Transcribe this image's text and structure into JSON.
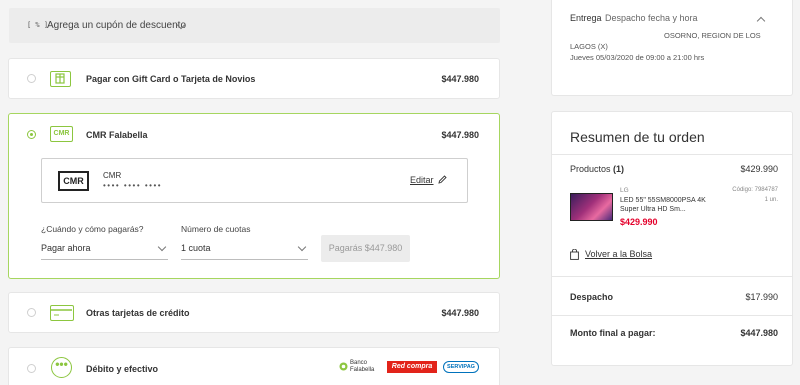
{
  "coupon": {
    "icon_text": "[ % ]",
    "label": "Agrega un cupón de descuento"
  },
  "payment_methods": {
    "giftcard": {
      "label": "Pagar con Gift Card o Tarjeta de Novios",
      "price": "$447.980"
    },
    "cmr": {
      "label": "CMR Falabella",
      "price": "$447.980",
      "icon_text": "CMR",
      "card": {
        "logo_text": "CMR",
        "name": "CMR",
        "masked_number": "•••• •••• ••••",
        "edit_label": "Editar"
      },
      "when_label": "¿Cuándo y cómo pagarás?",
      "when_value": "Pagar ahora",
      "installments_label": "Número de cuotas",
      "installments_value": "1 cuota",
      "pay_button": "Pagarás $447.980"
    },
    "credit": {
      "label": "Otras tarjetas de crédito",
      "price": "$447.980"
    },
    "debit": {
      "label": "Débito y efectivo",
      "logos": {
        "banco_line1": "Banco",
        "banco_line2": "Falabella",
        "redcompra": "Red compra",
        "servipag": "SERVIPAG"
      }
    }
  },
  "delivery": {
    "label": "Entrega",
    "sub_label": "Despacho fecha y hora",
    "address_line1": "OSORNO, REGION DE LOS",
    "address_line2": "LAGOS (X)",
    "schedule": "Jueves 05/03/2020 de 09:00 a 21:00 hrs"
  },
  "summary": {
    "title": "Resumen de tu orden",
    "products_label": "Productos",
    "products_count": "(1)",
    "products_total": "$429.990",
    "product": {
      "brand": "LG",
      "name_line1": "LED 55\" 55SM8000PSA 4K",
      "name_line2": "Super Ultra HD Sm...",
      "price": "$429.990",
      "code": "Código: 7984787",
      "qty": "1 un."
    },
    "back_label": "Volver a la Bolsa",
    "shipping_label": "Despacho",
    "shipping_value": "$17.990",
    "final_label": "Monto final a pagar:",
    "final_value": "$447.980"
  },
  "colors": {
    "accent_green": "#8cc63f",
    "sale_red": "#e4002b",
    "redcompra_red": "#e2231a",
    "servipag_blue": "#0072bc"
  }
}
